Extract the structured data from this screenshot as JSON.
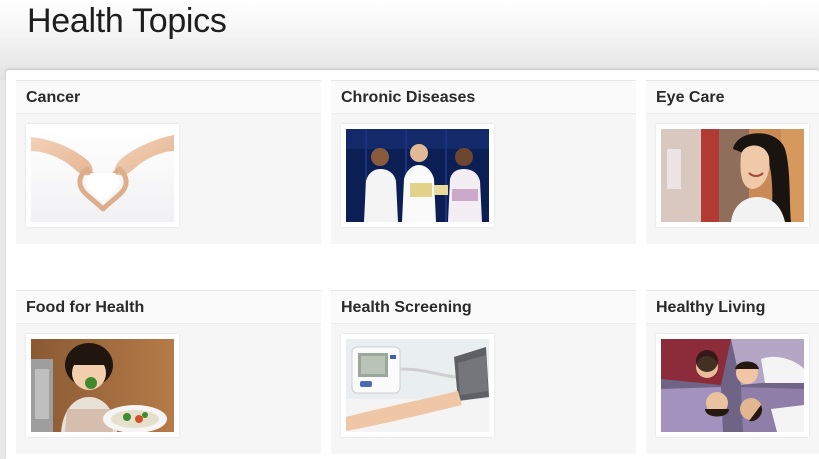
{
  "page": {
    "title": "Health Topics"
  },
  "topics": [
    {
      "label": "Cancer",
      "image": "hands-heart-image"
    },
    {
      "label": "Chronic Diseases",
      "image": "group-reading-leaflets-image"
    },
    {
      "label": "Eye Care",
      "image": "woman-smiling-image"
    },
    {
      "label": "Food for Health",
      "image": "child-eating-vegetables-image"
    },
    {
      "label": "Health Screening",
      "image": "blood-pressure-monitor-image"
    },
    {
      "label": "Healthy Living",
      "image": "friends-lying-together-image"
    }
  ]
}
